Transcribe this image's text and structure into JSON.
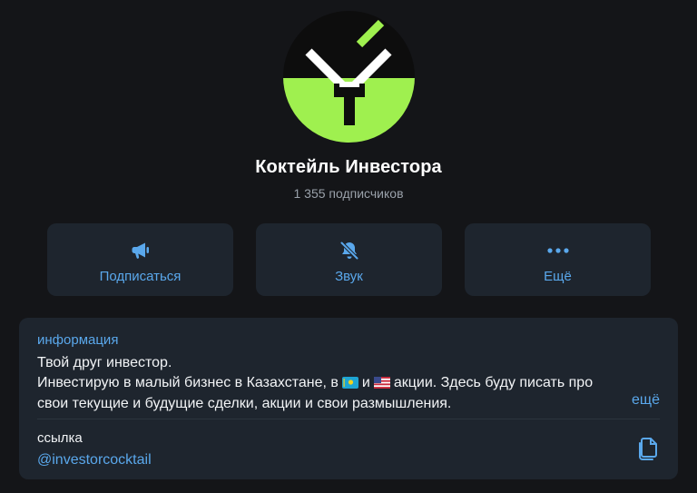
{
  "channel": {
    "name": "Коктейль Инвестора",
    "subscribers": "1 355 подписчиков",
    "avatar_icon": "investor-cocktail-logo",
    "avatar_colors": {
      "top": "#0d0d0d",
      "bottom": "#9ff04f",
      "accent": "#9ff04f",
      "mark": "#ffffff"
    }
  },
  "actions": {
    "subscribe": {
      "label": "Подписаться",
      "icon": "megaphone-icon"
    },
    "sound": {
      "label": "Звук",
      "icon": "bell-muted-icon"
    },
    "more": {
      "label": "Ещё",
      "icon": "more-dots-icon"
    }
  },
  "info": {
    "heading": "информация",
    "line1": "Твой друг инвестор.",
    "line2_part1": "Инвестирую в малый бизнес в Казахстане, в",
    "line2_part2": "и",
    "line2_part3": "акции. Здесь буду писать про",
    "line3": "свои текущие и будущие сделки, акции и свои размышления.",
    "flags": [
      "flag-kazakhstan-icon",
      "flag-usa-icon"
    ],
    "more_label": "ещё"
  },
  "link": {
    "label": "ссылка",
    "value": "@investorcocktail",
    "copy_icon": "copy-icon"
  },
  "colors": {
    "background": "#141518",
    "card": "#1e252e",
    "accent": "#5aa8ec",
    "secondary_text": "#9aa1aa"
  }
}
